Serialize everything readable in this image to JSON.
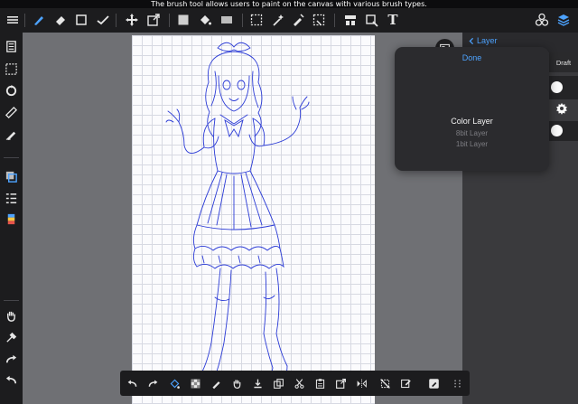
{
  "hint": {
    "text": "The brush tool allows users to paint on the canvas with various brush types."
  },
  "top_toolbar": {
    "tools": [
      {
        "name": "menu-icon",
        "active": false
      },
      {
        "name": "brush-icon",
        "active": true
      },
      {
        "name": "eraser-icon",
        "active": false
      },
      {
        "name": "shape-icon",
        "active": false
      },
      {
        "name": "correction-icon",
        "active": false
      },
      {
        "name": "move-icon",
        "active": false
      },
      {
        "name": "transform-icon",
        "active": false
      },
      {
        "name": "fill-color-icon",
        "active": false
      },
      {
        "name": "bucket-icon",
        "active": false
      },
      {
        "name": "gradient-icon",
        "active": false
      },
      {
        "name": "select-icon",
        "active": false
      },
      {
        "name": "magic-wand-icon",
        "active": false
      },
      {
        "name": "pen-select-icon",
        "active": false
      },
      {
        "name": "lasso-icon",
        "active": false
      },
      {
        "name": "panel-icon",
        "active": false
      },
      {
        "name": "zoom-icon",
        "active": false
      },
      {
        "name": "text-icon",
        "active": false
      },
      {
        "name": "materials-icon",
        "active": false
      },
      {
        "name": "layers-icon",
        "active": false
      }
    ],
    "text_tool_label": "T"
  },
  "layer_panel": {
    "back_label": "Layer",
    "draft_label": "Draft"
  },
  "layer_type_popover": {
    "done_label": "Done",
    "options": [
      {
        "label": "Color Layer",
        "selected": true
      },
      {
        "label": "8bit Layer",
        "selected": false
      },
      {
        "label": "1bit Layer",
        "selected": false
      }
    ]
  },
  "colors": {
    "accent": "#4da3ff",
    "toolbar_bg": "#1c1c1e",
    "panel_bg": "#3a3a3d",
    "canvas_bg": "#fbfbfd",
    "sketch_line": "#2b3bd6"
  }
}
